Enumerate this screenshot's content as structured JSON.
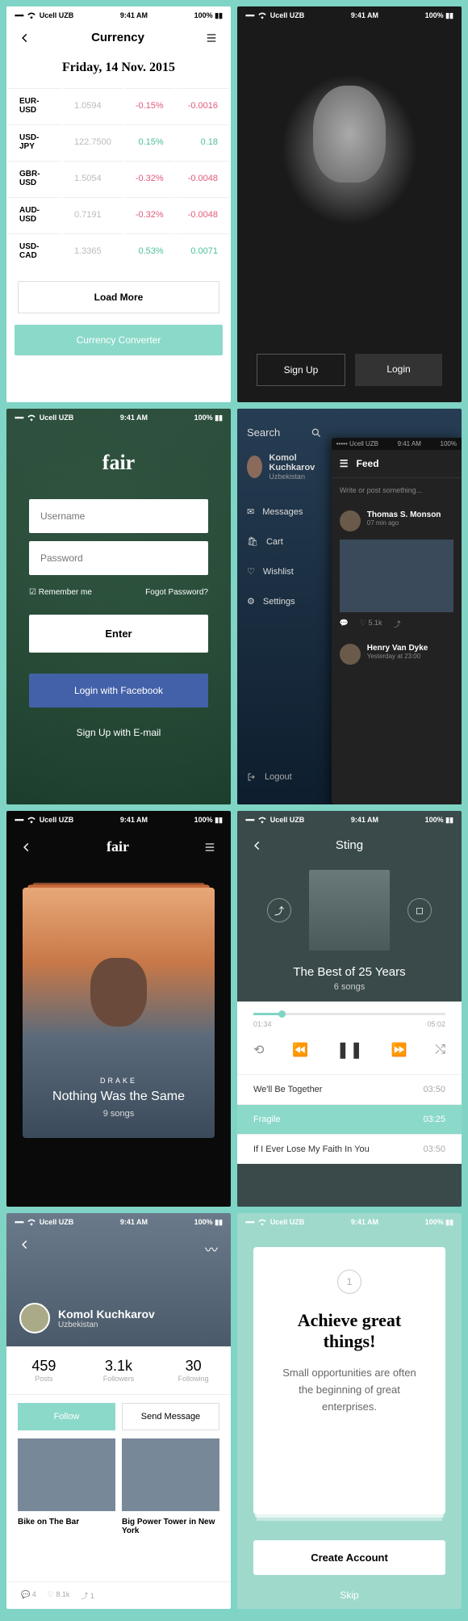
{
  "statusbar": {
    "carrier": "Ucell UZB",
    "time": "9:41 AM",
    "battery": "100%"
  },
  "s1": {
    "title": "Currency",
    "date": "Friday, 14 Nov. 2015",
    "rows": [
      {
        "pair": "EUR-USD",
        "rate": "1.0594",
        "pct": "-0.15%",
        "delta": "-0.0016",
        "sign": "neg"
      },
      {
        "pair": "USD-JPY",
        "rate": "122.7500",
        "pct": "0.15%",
        "delta": "0.18",
        "sign": "pos"
      },
      {
        "pair": "GBR-USD",
        "rate": "1.5054",
        "pct": "-0.32%",
        "delta": "-0.0048",
        "sign": "neg"
      },
      {
        "pair": "AUD-USD",
        "rate": "0.7191",
        "pct": "-0.32%",
        "delta": "-0.0048",
        "sign": "neg"
      },
      {
        "pair": "USD-CAD",
        "rate": "1.3365",
        "pct": "0.53%",
        "delta": "0.0071",
        "sign": "pos"
      }
    ],
    "loadmore": "Load More",
    "converter": "Currency Converter"
  },
  "s2": {
    "signup": "Sign Up",
    "login": "Login"
  },
  "s3": {
    "logo": "fair",
    "username_ph": "Username",
    "password_ph": "Password",
    "remember": "Remember me",
    "forgot": "Fogot Password?",
    "enter": "Enter",
    "fb": "Login with Facebook",
    "email": "Sign Up with E-mail"
  },
  "s4": {
    "search": "Search",
    "user": {
      "name": "Komol Kuchkarov",
      "sub": "Uzbekistan"
    },
    "menu": [
      {
        "icon": "mail",
        "label": "Messages"
      },
      {
        "icon": "cart",
        "label": "Cart"
      },
      {
        "icon": "heart",
        "label": "Wishlist"
      },
      {
        "icon": "gear",
        "label": "Settings"
      }
    ],
    "logout": "Logout",
    "peek": {
      "title": "Feed",
      "placeholder": "Write or post something...",
      "posts": [
        {
          "name": "Thomas S. Monson",
          "time": "07 min ago",
          "stat": "5.1k"
        },
        {
          "name": "Henry Van Dyke",
          "time": "Yesterday at 23:00"
        }
      ]
    }
  },
  "s5": {
    "logo": "fair",
    "artist": "DRAKE",
    "title": "Nothing Was the Same",
    "count": "9 songs"
  },
  "s6": {
    "artist": "Sting",
    "album": "The Best of 25 Years",
    "count": "6 songs",
    "cur": "01:34",
    "total": "05:02",
    "tracks": [
      {
        "title": "We'll Be Together",
        "dur": "03:50"
      },
      {
        "title": "Fragile",
        "dur": "03:25",
        "active": true
      },
      {
        "title": "If I Ever Lose My Faith In You",
        "dur": "03:50"
      }
    ]
  },
  "s7": {
    "name": "Komol Kuchkarov",
    "loc": "Uzbekistan",
    "stats": [
      {
        "n": "459",
        "l": "Posts"
      },
      {
        "n": "3.1k",
        "l": "Followers"
      },
      {
        "n": "30",
        "l": "Following"
      }
    ],
    "follow": "Follow",
    "msg": "Send Message",
    "posts": [
      {
        "title": "Bike on The Bar"
      },
      {
        "title": "Big Power Tower in New York"
      }
    ],
    "bottom": {
      "c": "4",
      "l": "8.1k",
      "s": "1"
    }
  },
  "s8": {
    "step": "1",
    "title": "Achieve great things!",
    "body": "Small opportunities are often the beginning of great enterprises.",
    "create": "Create Account",
    "skip": "Skip"
  }
}
